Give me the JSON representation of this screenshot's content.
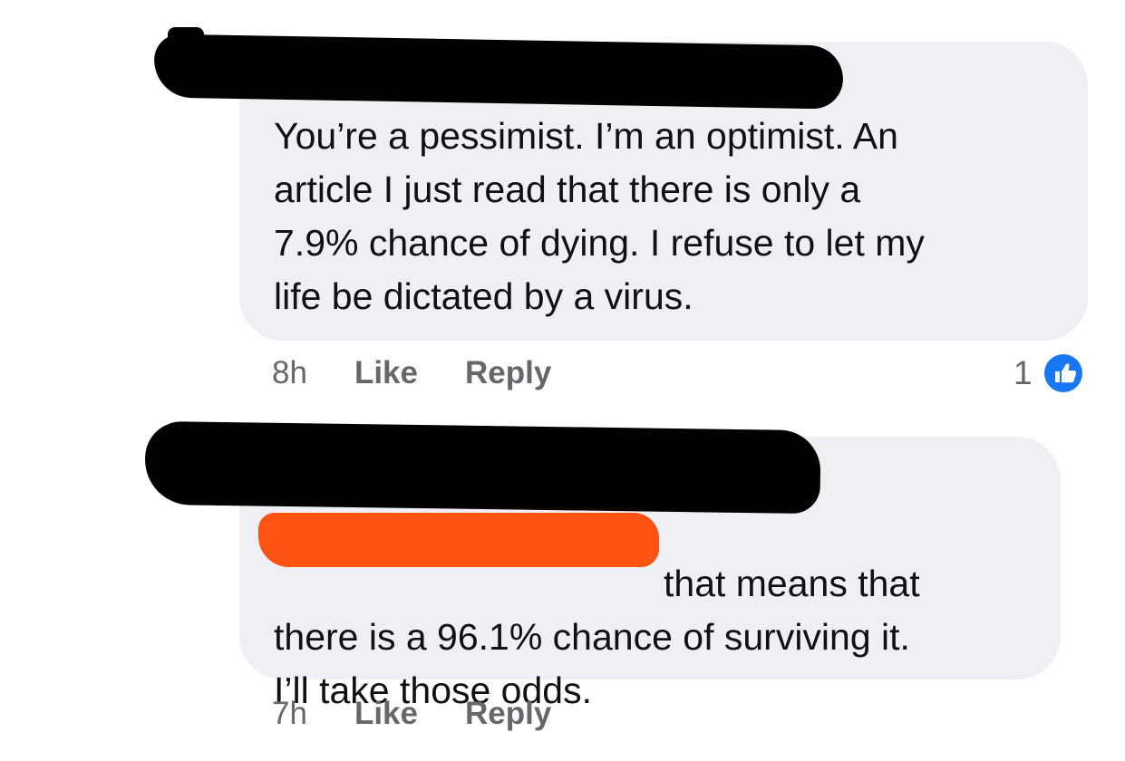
{
  "comments": [
    {
      "text": "You’re a pessimist. I’m an optimist.  An\narticle I just read that there is only a\n7.9% chance of dying.  I refuse to let my\nlife be dictated by a virus.",
      "time": "8h",
      "like_label": "Like",
      "reply_label": "Reply",
      "reaction_count": "1"
    },
    {
      "text": "that means that\nthere is a 96.1% chance of surviving it.\nI’ll take those odds.",
      "time": "7h",
      "like_label": "Like",
      "reply_label": "Reply"
    }
  ],
  "icons": {
    "reaction": "thumbs-up-icon"
  },
  "colors": {
    "bubble": "#eff0f4",
    "text": "#101113",
    "meta": "#65676b",
    "like_blue": "#1877f2",
    "redaction_black": "#000000",
    "redaction_orange": "#ff5313"
  }
}
